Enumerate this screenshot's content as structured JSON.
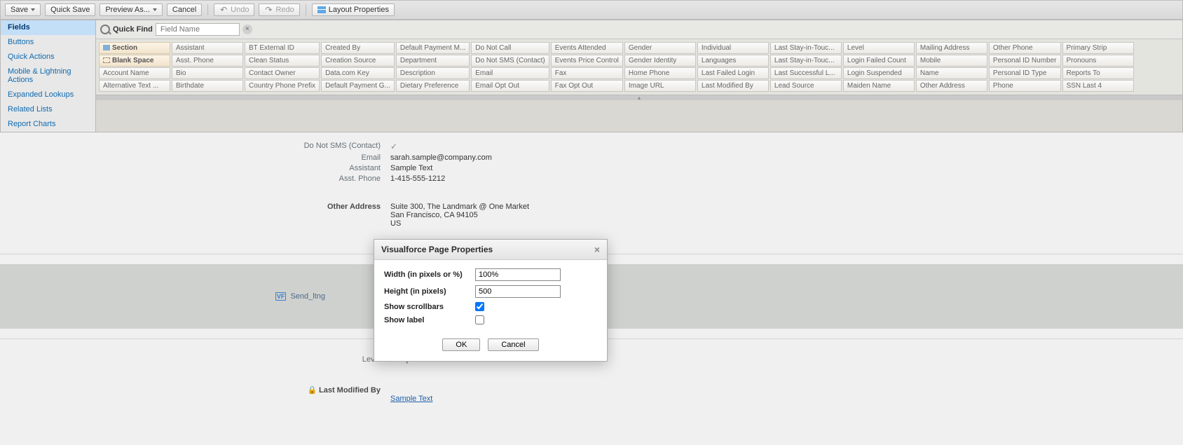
{
  "toolbar": {
    "save": "Save",
    "quick_save": "Quick Save",
    "preview_as": "Preview As...",
    "cancel": "Cancel",
    "undo": "Undo",
    "redo": "Redo",
    "layout_properties": "Layout Properties"
  },
  "palette": {
    "categories": [
      "Fields",
      "Buttons",
      "Quick Actions",
      "Mobile & Lightning Actions",
      "Expanded Lookups",
      "Related Lists",
      "Report Charts"
    ],
    "selected_index": 0,
    "quick_find_label": "Quick Find",
    "quick_find_placeholder": "Field Name",
    "special": {
      "section": "Section",
      "blank": "Blank Space"
    }
  },
  "fields_grid": [
    [
      "Account Name",
      "Alternative Text ..."
    ],
    [
      "Assistant",
      "Asst. Phone",
      "Bio",
      "Birthdate"
    ],
    [
      "BT External ID",
      "Clean Status",
      "Contact Owner",
      "Country Phone Prefix"
    ],
    [
      "Created By",
      "Creation Source",
      "Data.com Key",
      "Default Payment G..."
    ],
    [
      "Default Payment M...",
      "Department",
      "Description",
      "Dietary Preference"
    ],
    [
      "Do Not Call",
      "Do Not SMS (Contact)",
      "Email",
      "Email Opt Out"
    ],
    [
      "Events Attended",
      "Events Price Control",
      "Fax",
      "Fax Opt Out"
    ],
    [
      "Gender",
      "Gender Identity",
      "Home Phone",
      "Image URL"
    ],
    [
      "Individual",
      "Languages",
      "Last Failed Login",
      "Last Modified By"
    ],
    [
      "Last Stay-in-Touc...",
      "Last Stay-in-Touc...",
      "Last Successful L...",
      "Lead Source"
    ],
    [
      "Level",
      "Login Failed Count",
      "Login Suspended",
      "Maiden Name"
    ],
    [
      "Mailing Address",
      "Mobile",
      "Name",
      "Other Address"
    ],
    [
      "Other Phone",
      "Personal ID Number",
      "Personal ID Type",
      "Phone"
    ],
    [
      "Primary Strip",
      "Pronouns",
      "Reports To",
      "SSN Last 4"
    ]
  ],
  "detail": {
    "rows": [
      {
        "label": "Do Not SMS (Contact)",
        "type": "check"
      },
      {
        "label": "Email",
        "value": "sarah.sample@company.com"
      },
      {
        "label": "Assistant",
        "value": "Sample Text"
      },
      {
        "label": "Asst. Phone",
        "value": "1-415-555-1212"
      }
    ],
    "address_label": "Other Address",
    "address_value": "Suite 300, The Landmark @ One Market\nSan Francisco, CA 94105\nUS"
  },
  "vf": {
    "label": "Send_ltng",
    "icon_text": "VF"
  },
  "modal": {
    "title": "Visualforce Page Properties",
    "width_label": "Width (in pixels or %)",
    "width_value": "100%",
    "height_label": "Height (in pixels)",
    "height_value": "500",
    "scrollbars_label": "Show scrollbars",
    "scrollbars_checked": true,
    "showlabel_label": "Show label",
    "showlabel_checked": false,
    "ok": "OK",
    "cancel": "Cancel"
  },
  "bottom": {
    "level_label": "Level",
    "level_value": "Sample Text",
    "modified_label": "Last Modified By",
    "modified_value": "Sample Text"
  }
}
